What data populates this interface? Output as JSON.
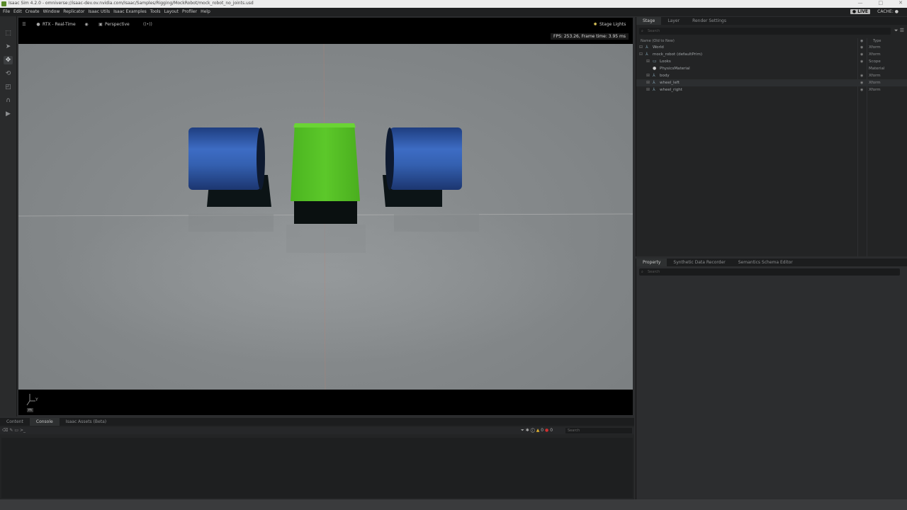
{
  "window": {
    "title": "Isaac Sim 4.2.0 - omniverse://isaac-dev.ov.nvidia.com/Isaac/Samples/Rigging/MockRobot/mock_robot_no_joints.usd",
    "controls": [
      "—",
      "□",
      "✕"
    ]
  },
  "menubar": {
    "items": [
      "File",
      "Edit",
      "Create",
      "Window",
      "Replicator",
      "Isaac Utils",
      "Isaac Examples",
      "Tools",
      "Layout",
      "Profiler",
      "Help"
    ],
    "live_label": "● LIVE",
    "cache_label": "CACHE: ●"
  },
  "viewport": {
    "menu_icon": "☰",
    "renderer_label": "RTX - Real-Time",
    "camera_label": "Perspective",
    "stage_lights_label": "Stage Lights",
    "fps_text": "FPS: 253.26, Frame time: 3.95 ms",
    "axis_label": "Y",
    "units_label": "m"
  },
  "stage": {
    "tabs": [
      "Stage",
      "Layer",
      "Render Settings"
    ],
    "search_placeholder": "Search",
    "col_name": "Name (Old to New)",
    "col_type": "Type",
    "rows": [
      {
        "name": "World",
        "type": "Xform"
      },
      {
        "name": "mock_robot (defaultPrim)",
        "type": "Xform"
      },
      {
        "name": "Looks",
        "type": "Scope"
      },
      {
        "name": "PhysicsMaterial",
        "type": "Material"
      },
      {
        "name": "body",
        "type": "Xform"
      },
      {
        "name": "wheel_left",
        "type": "Xform"
      },
      {
        "name": "wheel_right",
        "type": "Xform"
      }
    ]
  },
  "property": {
    "tabs": [
      "Property",
      "Synthetic Data Recorder",
      "Semantics Schema Editor"
    ],
    "search_placeholder": "Search"
  },
  "bottom": {
    "tabs": [
      "Content",
      "Console",
      "Isaac Assets (Beta)"
    ],
    "search_placeholder": "Search",
    "warn_count": "0",
    "error_count": "0"
  }
}
